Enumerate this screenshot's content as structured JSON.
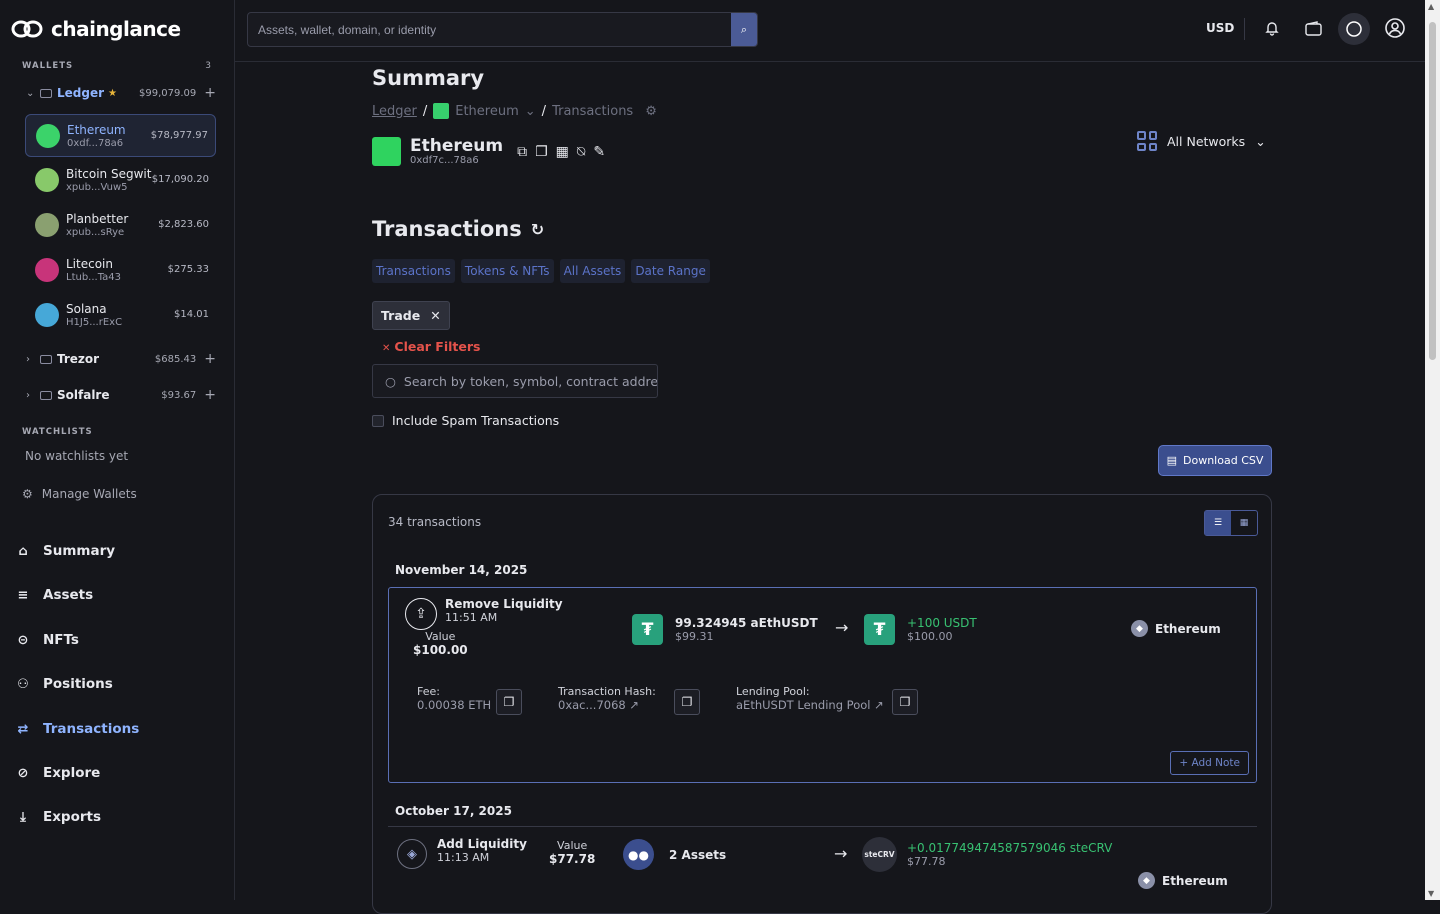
{
  "app": {
    "brand": "chainglance"
  },
  "sidebar": {
    "wallets_label": "WALLETS",
    "wallets_count": "3",
    "groups": [
      {
        "name": "Ledger",
        "star": "★",
        "amount": "$99,079.09",
        "plus": "+"
      },
      {
        "name": "Trezor",
        "amount": "$685.43",
        "plus": "+"
      },
      {
        "name": "Solfalre",
        "amount": "$93.67",
        "plus": "+"
      }
    ],
    "accounts": [
      {
        "name": "Ethereum",
        "addr": "0xdf...78a6",
        "value": "$78,977.97",
        "color": "#3bd36a"
      },
      {
        "name": "Bitcoin Segwit",
        "addr": "xpub...Vuw5",
        "value": "$17,090.20",
        "color": "#88c96a"
      },
      {
        "name": "Planbetter",
        "addr": "xpub...sRye",
        "value": "$2,823.60",
        "color": "#8aa070"
      },
      {
        "name": "Litecoin",
        "addr": "Ltub...Ta43",
        "value": "$275.33",
        "color": "#c8347a"
      },
      {
        "name": "Solana",
        "addr": "H1J5...rExC",
        "value": "$14.01",
        "color": "#46a8d8"
      }
    ],
    "watchlists_label": "WATCHLISTS",
    "watchlists_empty": "No watchlists yet",
    "manage": "Manage Wallets",
    "nav": [
      {
        "label": "Summary",
        "icon": "⌂"
      },
      {
        "label": "Assets",
        "icon": "≡"
      },
      {
        "label": "NFTs",
        "icon": "⊝"
      },
      {
        "label": "Positions",
        "icon": "⚇"
      },
      {
        "label": "Transactions",
        "icon": "⇄"
      },
      {
        "label": "Explore",
        "icon": "⊘"
      },
      {
        "label": "Exports",
        "icon": "⤓"
      }
    ]
  },
  "topbar": {
    "search_placeholder": "Assets, wallet, domain, or identity",
    "currency": "USD"
  },
  "main": {
    "page_title": "Summary",
    "breadcrumb": {
      "root": "Ledger",
      "sep": "/",
      "chain": "Ethereum",
      "current": "Transactions"
    },
    "account": {
      "name": "Ethereum",
      "addr": "0xdf7c...78a6"
    },
    "networks": "All Networks",
    "tx_title": "Transactions",
    "tabs": [
      "Transactions",
      "Tokens & NFTs",
      "All Assets",
      "Date Range"
    ],
    "chip": "Trade",
    "clear": "Clear Filters",
    "token_search_placeholder": "Search by token, symbol, contract address",
    "spam_label": "Include Spam Transactions",
    "csv": "Download CSV",
    "count": "34 transactions",
    "groups": [
      {
        "date": "November 14, 2025",
        "tx": {
          "type": "Remove Liquidity",
          "time": "11:51 AM",
          "value_label": "Value",
          "value": "$100.00",
          "from_amt": "99.324945 aEthUSDT",
          "from_usd": "$99.31",
          "to_amt": "+100 USDT",
          "to_usd": "$100.00",
          "network": "Ethereum",
          "fee_label": "Fee:",
          "fee": "0.00038 ETH",
          "hash_label": "Transaction Hash:",
          "hash": "0xac...7068",
          "pool_label": "Lending Pool:",
          "pool": "aEthUSDT Lending Pool",
          "note": "Add Note"
        }
      },
      {
        "date": "October 17, 2025",
        "tx": {
          "type": "Add Liquidity",
          "time": "11:13 AM",
          "value_label": "Value",
          "value": "$77.78",
          "from_amt": "2 Assets",
          "to_amt": "+0.017749474587579046 steCRV",
          "to_usd": "$77.78",
          "token_label": "steCRV",
          "network": "Ethereum"
        }
      }
    ]
  }
}
